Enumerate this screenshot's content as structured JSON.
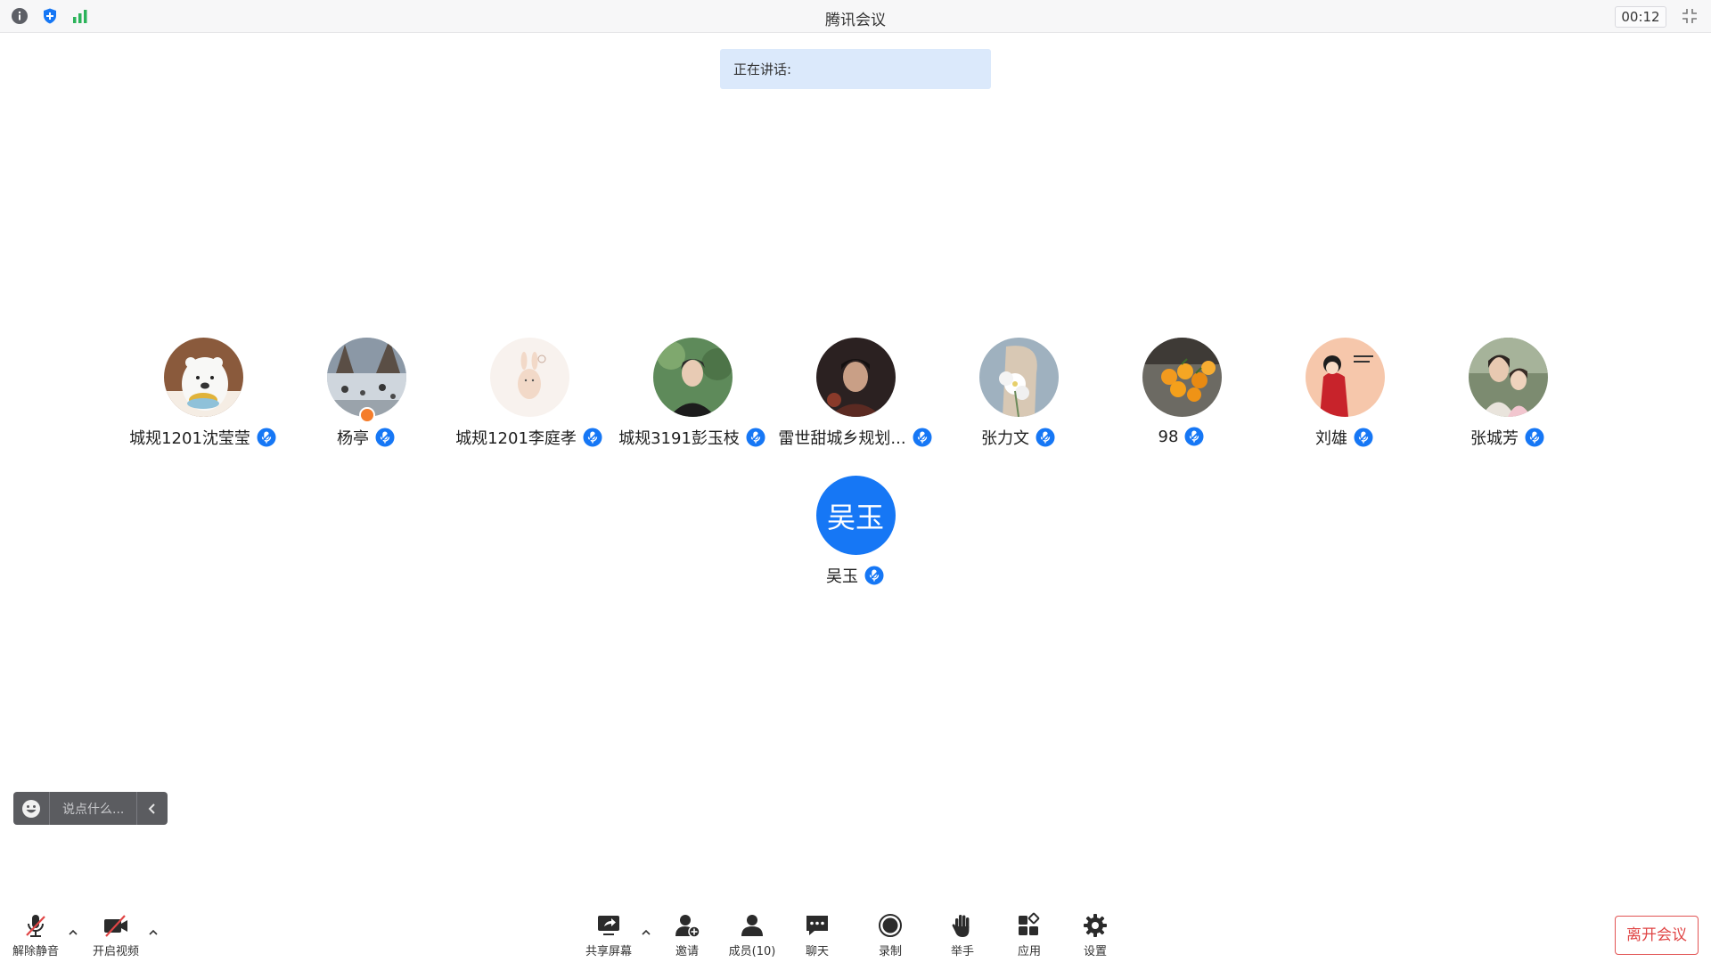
{
  "app": {
    "title": "腾讯会议",
    "timer": "00:12"
  },
  "speaking": {
    "label": "正在讲话:"
  },
  "participants": [
    {
      "name": "城规1201沈莹莹",
      "avatar": "polar-bear-avatar"
    },
    {
      "name": "杨亭",
      "avatar": "landscape-photo-avatar",
      "host": true
    },
    {
      "name": "城规1201李庭孝",
      "avatar": "bunny-avatar"
    },
    {
      "name": "城规3191彭玉枝",
      "avatar": "portrait-photo-avatar"
    },
    {
      "name": "雷世甜城乡规划...",
      "avatar": "dark-photo-avatar"
    },
    {
      "name": "张力文",
      "avatar": "flower-avatar"
    },
    {
      "name": "98",
      "avatar": "fruit-avatar"
    },
    {
      "name": "刘雄",
      "avatar": "cartoon-avatar"
    },
    {
      "name": "张城芳",
      "avatar": "family-photo-avatar"
    },
    {
      "name": "吴玉",
      "avatar_text": "吴玉"
    }
  ],
  "chat": {
    "placeholder": "说点什么..."
  },
  "toolbar": {
    "unmute": "解除静音",
    "start_video": "开启视频",
    "share_screen": "共享屏幕",
    "invite": "邀请",
    "members": "成员(10)",
    "chat": "聊天",
    "record": "录制",
    "raise_hand": "举手",
    "apps": "应用",
    "settings": "设置",
    "leave": "离开会议"
  },
  "colors": {
    "accent": "#1677f5",
    "leave": "#e04545",
    "banner": "#dbe9fb"
  }
}
